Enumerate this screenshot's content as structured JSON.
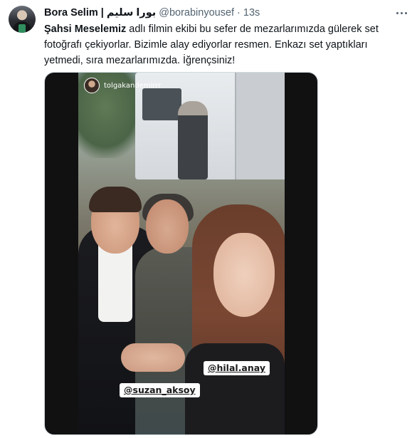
{
  "tweet": {
    "display_name": "Bora Selim | بورا سليم",
    "handle": "@borabinyousef",
    "separator": "·",
    "time": "13s",
    "text_bold": "Şahsi Meselemiz",
    "text_rest": " adlı filmin ekibi bu sefer de mezarlarımızda gülerek set fotoğrafı çekiyorlar. Bizimle alay ediyorlar resmen. Enkazı set yaptıkları yetmedi, sıra mezarlarımızda. İğrençsiniz!",
    "more_icon": "more-horizontal-icon"
  },
  "media": {
    "story_username": "tolgakandemirrr",
    "story_time": "·",
    "tags": {
      "hilal": "@hilal.anay",
      "suzan": "@suzan_aksoy"
    }
  },
  "colors": {
    "text_primary": "#0f1419",
    "text_secondary": "#536471",
    "media_bg": "#111111",
    "border": "#cfd9de"
  }
}
